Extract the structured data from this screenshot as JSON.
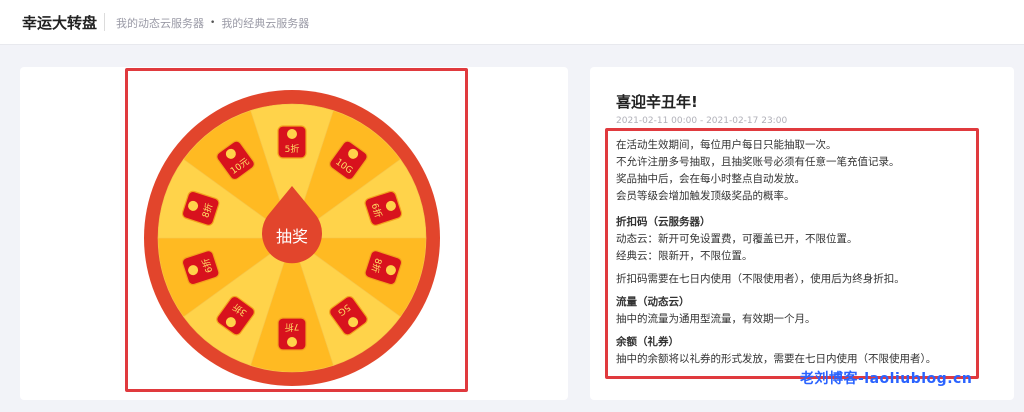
{
  "header": {
    "title": "幸运大转盘",
    "breadcrumbs": [
      "我的动态云服务器",
      "我的经典云服务器"
    ],
    "separator": "•"
  },
  "wheel": {
    "center_label": "抽奖",
    "prizes": [
      "5折",
      "10G",
      "6折",
      "8折",
      "5G",
      "7折",
      "3折",
      "6折",
      "8折",
      "10元"
    ],
    "colors": {
      "rim": "#e2452c",
      "light": "#ffd34a",
      "dark": "#ffba22",
      "envelope": "#d8121d",
      "hub": "#e2452c"
    }
  },
  "info": {
    "title": "喜迎辛丑年!",
    "date_range": "2021-02-11 00:00 - 2021-02-17 23:00",
    "rules": [
      "在活动生效期间，每位用户每日只能抽取一次。",
      "不允许注册多号抽取，且抽奖账号必须有任意一笔充值记录。",
      "奖品抽中后，会在每小时整点自动发放。",
      "会员等级会增加触发顶级奖品的概率。"
    ],
    "discount": {
      "heading": "折扣码（云服务器）",
      "lines": [
        "动态云：新开可免设置费，可覆盖已开，不限位置。",
        "经典云：限新开，不限位置。"
      ],
      "note": "折扣码需要在七日内使用（不限使用者），使用后为终身折扣。"
    },
    "traffic": {
      "heading": "流量（动态云）",
      "line": "抽中的流量为通用型流量，有效期一个月。"
    },
    "balance": {
      "heading": "余额（礼券）",
      "line": "抽中的余额将以礼券的形式发放，需要在七日内使用（不限使用者）。"
    }
  },
  "watermark": "老刘博客-laoliublog.cn"
}
